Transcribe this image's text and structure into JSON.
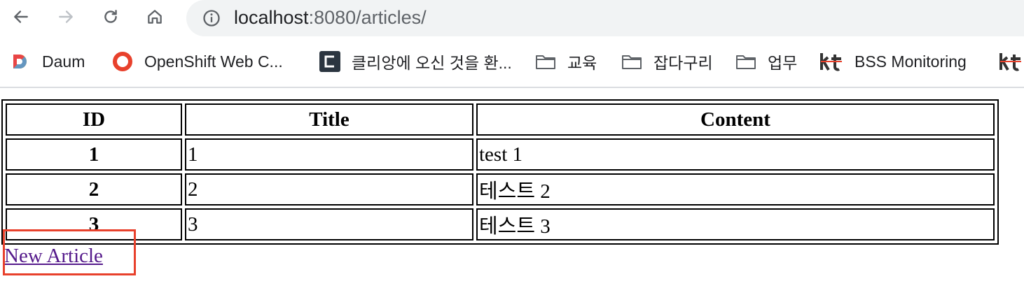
{
  "browser": {
    "url_host": "localhost",
    "url_path": ":8080/articles/",
    "icons": {
      "back": "arrow-left-icon",
      "forward": "arrow-right-icon",
      "reload": "reload-icon",
      "home": "home-icon",
      "site_info": "info-icon"
    },
    "bookmarks": [
      {
        "label": "Daum",
        "icon": "daum-logo-icon"
      },
      {
        "label": "OpenShift Web C...",
        "icon": "openshift-logo-icon"
      },
      {
        "label": "클리앙에 오신 것을 환...",
        "icon": "clien-logo-icon"
      },
      {
        "label": "교육",
        "icon": "folder-icon"
      },
      {
        "label": "잡다구리",
        "icon": "folder-icon"
      },
      {
        "label": "업무",
        "icon": "folder-icon"
      },
      {
        "label": "BSS Monitoring",
        "icon": "kt-logo-icon"
      }
    ]
  },
  "page": {
    "table": {
      "headers": [
        "ID",
        "Title",
        "Content"
      ],
      "rows": [
        {
          "id": "1",
          "title": "1",
          "content": "test 1"
        },
        {
          "id": "2",
          "title": "2",
          "content": "테스트 2"
        },
        {
          "id": "3",
          "title": "3",
          "content": "테스트 3"
        }
      ]
    },
    "new_article_label": "New Article"
  },
  "colors": {
    "link_visited": "#551a8b",
    "highlight": "#e8412c",
    "addressbar_bg": "#f1f3f4"
  }
}
